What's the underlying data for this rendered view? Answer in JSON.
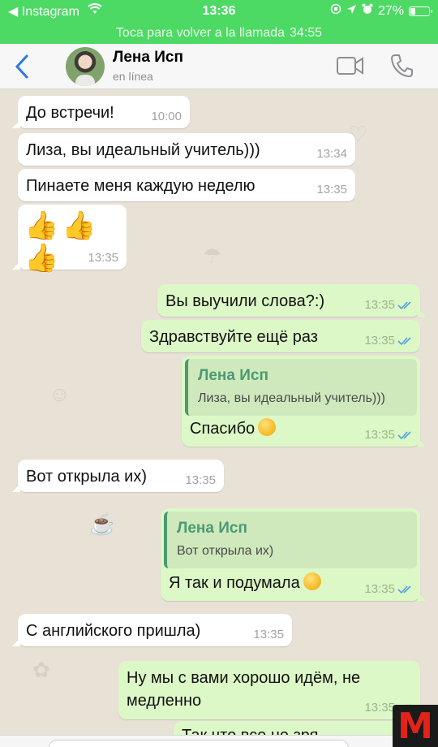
{
  "status_bar": {
    "back_app": "◀ Instagram",
    "time": "13:36",
    "battery": "27%",
    "battery_level": 0.27
  },
  "call_bar": {
    "text": "Toca para volver a la llamada",
    "duration": "34:55"
  },
  "header": {
    "name": "Лена Исп",
    "status": "en línea"
  },
  "messages": [
    {
      "dir": "in",
      "text": "До встречи!",
      "time": "10:00"
    },
    {
      "dir": "in",
      "text": "Лиза, вы идеальный учитель)))",
      "time": "13:34"
    },
    {
      "dir": "in",
      "text": "Пинаете меня каждую неделю",
      "time": "13:35"
    },
    {
      "dir": "in",
      "emoji": "thumbs-up x3",
      "time": "13:35"
    },
    {
      "dir": "out",
      "text": "Вы выучили слова?:)",
      "time": "13:35",
      "read": true
    },
    {
      "dir": "out",
      "text": "Здравствуйте ещё раз",
      "time": "13:35",
      "read": true
    },
    {
      "dir": "out",
      "quote_name": "Лена Исп",
      "quote_text": "Лиза, вы идеальный учитель)))",
      "text": "Спасибо",
      "emoji": "winking-face",
      "time": "13:35",
      "read": true
    },
    {
      "dir": "in",
      "text": "Вот открыла их)",
      "time": "13:35"
    },
    {
      "dir": "out",
      "quote_name": "Лена Исп",
      "quote_text": "Вот открыла их)",
      "text": "Я так и подумала",
      "emoji": "upside-down-face",
      "time": "13:35",
      "read": true
    },
    {
      "dir": "in",
      "text": "С английского пришла)",
      "time": "13:35"
    },
    {
      "dir": "out",
      "text": "Ну мы с вами хорошо идём, не медленно",
      "time": "13:35",
      "read": true
    },
    {
      "dir": "out",
      "text": "Так что все не зря",
      "partial": true
    }
  ],
  "colors": {
    "status_green": "#4cd964",
    "chat_bg": "#e8e1d6",
    "bubble_in": "#ffffff",
    "bubble_out": "#dcf8c6",
    "read_ticks": "#4fa3e0",
    "quote_accent": "#4b9a73",
    "ios_blue": "#2b7ae0"
  },
  "watermark": "M"
}
